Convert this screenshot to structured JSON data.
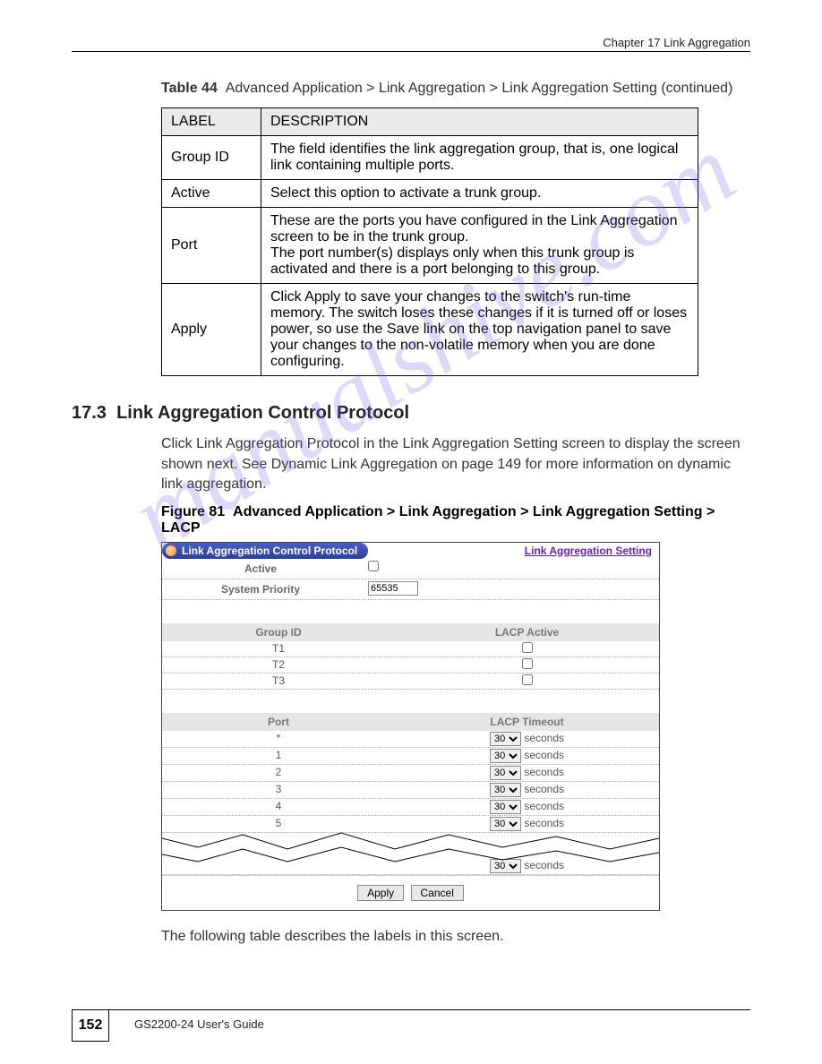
{
  "chapterHead": "Chapter 17 Link Aggregation",
  "paramTable": {
    "head1": "LABEL",
    "head2": "DESCRIPTION",
    "rows": [
      {
        "label": "Group ID",
        "desc": "The field identifies the link aggregation group, that is, one logical link containing multiple ports."
      },
      {
        "label": "Active",
        "desc": "Select this option to activate a trunk group."
      },
      {
        "label": "Port",
        "desc": "These are the ports you have configured in the Link Aggregation screen to be in the trunk group.\nThe port number(s) displays only when this trunk group is activated and there is a port belonging to this group."
      },
      {
        "label": "Apply",
        "desc": "Click Apply to save your changes to the switch's run-time memory. The switch loses these changes if it is turned off or loses power, so use the Save link on the top navigation panel to save your changes to the non-volatile memory when you are done configuring."
      }
    ]
  },
  "sectionNum": "17.3",
  "sectionTitle": "Link Aggregation Control Protocol",
  "paragraph": "Click Link Aggregation Protocol in the Link Aggregation Setting screen to display the screen shown next. See Dynamic Link Aggregation on page 149 for more information on dynamic link aggregation.",
  "figureLabel": "Figure 81",
  "figureTitle": "Advanced Application > Link Aggregation > Link Aggregation Setting > LACP",
  "ui": {
    "title": "Link Aggregation Control Protocol",
    "linkRight": "Link Aggregation Setting",
    "activeLabel": "Active",
    "sysPrioLabel": "System Priority",
    "sysPrioValue": "65535",
    "groupIdHead": "Group ID",
    "lacpActiveHead": "LACP Active",
    "groups": [
      "T1",
      "T2",
      "T3"
    ],
    "portHead": "Port",
    "timeoutHead": "LACP Timeout",
    "timeoutVal": "30",
    "timeoutUnit": "seconds",
    "ports": [
      "*",
      "1",
      "2",
      "3",
      "4",
      "5"
    ],
    "apply": "Apply",
    "cancel": "Cancel"
  },
  "tableCaption": "Table 44",
  "tableCaptionText": "Advanced Application > Link Aggregation > Link Aggregation Setting (continued)",
  "lowerPara": "The following table describes the labels in this screen.",
  "pageNum": "152",
  "footText": "GS2200-24 User's Guide",
  "watermark": "manualshive.com"
}
